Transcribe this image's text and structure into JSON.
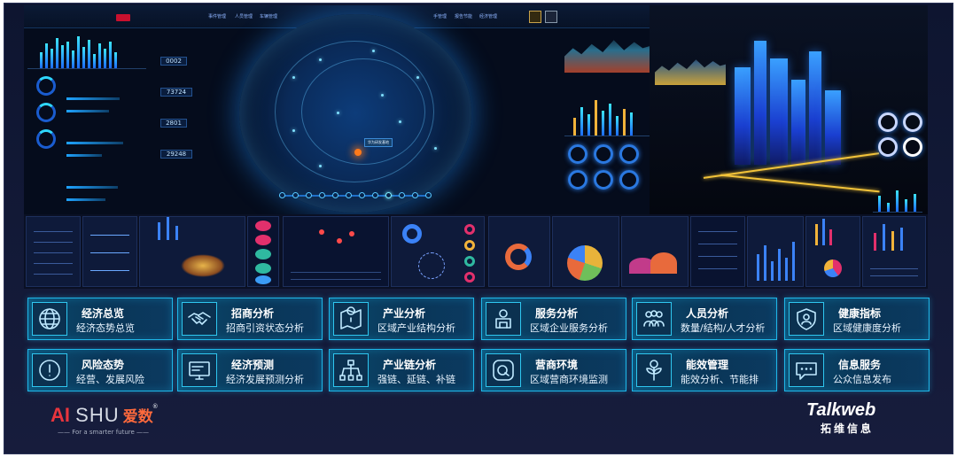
{
  "modules": [
    {
      "title": "经济总览",
      "subtitle": "经济态势总览",
      "icon": "globe-icon"
    },
    {
      "title": "招商分析",
      "subtitle": "招商引资状态分析",
      "icon": "handshake-icon"
    },
    {
      "title": "产业分析",
      "subtitle": "区域产业结构分析",
      "icon": "map-pin-icon"
    },
    {
      "title": "服务分析",
      "subtitle": "区域企业服务分析",
      "icon": "service-person-icon"
    },
    {
      "title": "人员分析",
      "subtitle": "数量/结构/人才分析",
      "icon": "people-group-icon"
    },
    {
      "title": "健康指标",
      "subtitle": "区域健康度分析",
      "icon": "shield-person-icon"
    },
    {
      "title": "风险态势",
      "subtitle": "经营、发展风险",
      "icon": "warning-icon"
    },
    {
      "title": "经济预测",
      "subtitle": "经济发展预测分析",
      "icon": "monitor-icon"
    },
    {
      "title": "产业链分析",
      "subtitle": "强链、延链、补链",
      "icon": "chain-network-icon"
    },
    {
      "title": "营商环境",
      "subtitle": "区域营商环境监测",
      "icon": "chat-bubble-icon"
    },
    {
      "title": "能效管理",
      "subtitle": "能效分析、节能排",
      "icon": "plant-gear-icon"
    },
    {
      "title": "信息服务",
      "subtitle": "公众信息发布",
      "icon": "message-dots-icon"
    }
  ],
  "dashboard": {
    "nav_tabs": [
      "事件管理",
      "人员管理",
      "车辆管理",
      "手管理",
      "报告节能",
      "经济管理"
    ],
    "counters": [
      "0002",
      "73724",
      "2801",
      "29248"
    ],
    "hub_label": "华为研发基地",
    "timeline_ticks": 12
  },
  "brand_left": {
    "a": "A",
    "i": "I",
    "shu": "SHU",
    "cn": "爱数",
    "reg": "®",
    "slogan": "—— For a smarter future ——"
  },
  "brand_right": {
    "name": "Talkweb",
    "cn": "拓维信息"
  },
  "colors": {
    "accent": "#1fb6e8",
    "card_bg": "#0a3658",
    "brand_red": "#e8353d"
  }
}
